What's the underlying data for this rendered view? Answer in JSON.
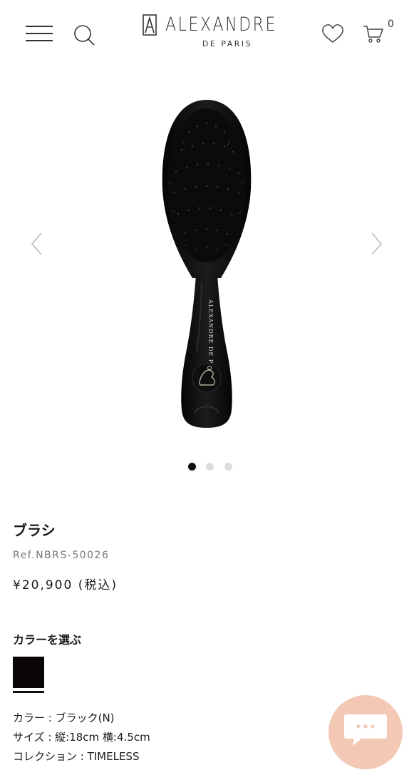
{
  "header": {
    "logo_main": "ALEXANDRE",
    "logo_sub": "DE PARIS",
    "cart_count": "0",
    "icons": {
      "menu": "hamburger-menu-icon",
      "search": "search-icon",
      "wishlist": "heart-icon",
      "cart": "cart-icon"
    }
  },
  "gallery": {
    "slide_count": 3,
    "active_slide": 1,
    "image": "black oval hair brush with boar bristles and gold emblem"
  },
  "product": {
    "title": "ブラシ",
    "ref": "Ref.NBRS-50026",
    "price": "¥20,900 (税込)"
  },
  "color_picker": {
    "label": "カラーを選ぶ",
    "selected_color": "#0a0507"
  },
  "details": {
    "color": "カラー : ブラック(N)",
    "size": "サイズ : 縦:18cm 横:4.5cm",
    "collection": "コレクション : TIMELESS"
  },
  "chat": {
    "icon": "chat-bubble-icon",
    "color": "#f3c8b5"
  }
}
